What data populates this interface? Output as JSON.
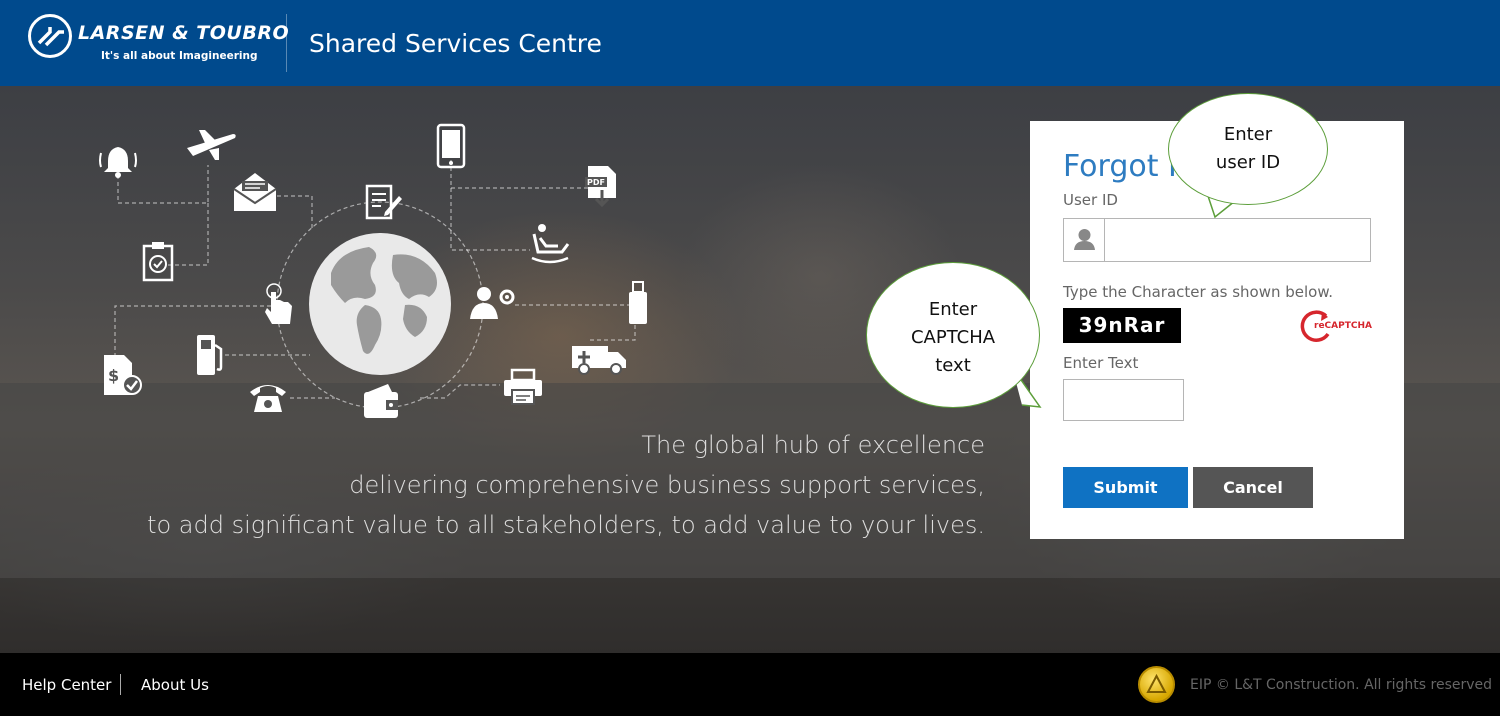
{
  "header": {
    "brand_name": "LARSEN & TOUBRO",
    "brand_tagline": "It's all about Imagineering",
    "app_title": "Shared Services Centre",
    "header_color": "#004a8d"
  },
  "hero": {
    "tagline_lines": [
      "The global hub of excellence",
      "delivering comprehensive business support services,",
      "to add significant value to all stakeholders, to add value to your lives."
    ],
    "icons": [
      "bell-icon",
      "airplane-icon",
      "mobile-phone-icon",
      "envelope-icon",
      "clipboard-icon",
      "document-edit-icon",
      "pdf-download-icon",
      "recliner-icon",
      "globe-icon",
      "touch-icon",
      "fuel-pump-icon",
      "user-settings-icon",
      "usb-drive-icon",
      "ambulance-icon",
      "invoice-dollar-icon",
      "telephone-icon",
      "wallet-icon",
      "printer-icon"
    ]
  },
  "form": {
    "title": "Forgot P",
    "user_id_label": "User ID",
    "user_id_value": "",
    "captcha_instruction": "Type the Character as shown below.",
    "captcha_text": "39nRar",
    "recaptcha_label": "reCAPTCHA",
    "enter_text_label": "Enter Text",
    "captcha_input_value": "",
    "submit_label": "Submit",
    "cancel_label": "Cancel",
    "accent_color": "#0f72c3"
  },
  "callouts": {
    "user_id": [
      "Enter",
      "user ID"
    ],
    "captcha": [
      "Enter",
      "CAPTCHA",
      "text"
    ],
    "border_color": "#5c9e3a"
  },
  "footer": {
    "help_center": "Help Center",
    "about_us": "About Us",
    "copyright": "EIP © L&T Construction. All rights reserved"
  }
}
